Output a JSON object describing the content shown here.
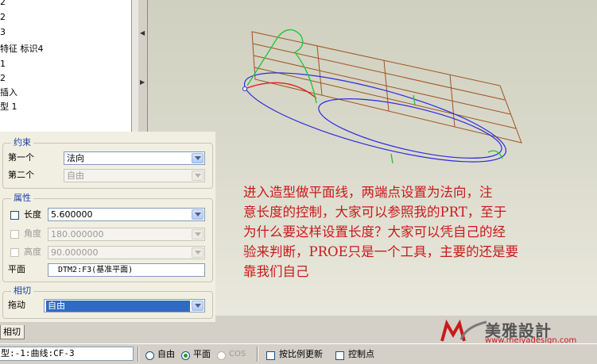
{
  "tree": {
    "items": [
      "2",
      "2",
      "3",
      "特征 标识4",
      "1",
      "2",
      "插入",
      "型 1"
    ]
  },
  "constraints": {
    "title": "约束",
    "first_label": "第一个",
    "first_value": "法向",
    "second_label": "第二个",
    "second_value": "自由"
  },
  "properties": {
    "title": "属性",
    "length_label": "长度",
    "length_value": "5.600000",
    "angle_label": "角度",
    "angle_value": "180.000000",
    "height_label": "高度",
    "height_value": "90.000000",
    "plane_label": "平面",
    "plane_value": "DTM2:F3(基准平面)"
  },
  "tangent": {
    "title": "相切",
    "drag_label": "拖动",
    "drag_value": "自由"
  },
  "tab_label": "相切",
  "statusbar": {
    "curve_text": "型:-1:曲线:CF-3",
    "radio_free": "自由",
    "radio_plane": "平面",
    "radio_cos": "COS",
    "check_scale": "按比例更新",
    "check_ctrl": "控制点"
  },
  "note_lines": [
    "  进入造型做平面线，两端点设置为法向，注",
    "意长度的控制，大家可以参照我的PRT，至于",
    "为什么要这样设置长度？大家可以凭自己的经",
    "验来判断，PROE只是一个工具，主要的还是要",
    "靠我们自己"
  ],
  "logo": {
    "name": "美雅設計",
    "url": "www.meiyadesign.com"
  },
  "colors": {
    "grid": "#a0521e",
    "ellipse": "#2b2be0",
    "green_curve": "#22c83a",
    "red_curve": "#e02020",
    "note": "#c81a1a",
    "group_title": "#1a3fa8",
    "selection": "#316ac5"
  }
}
